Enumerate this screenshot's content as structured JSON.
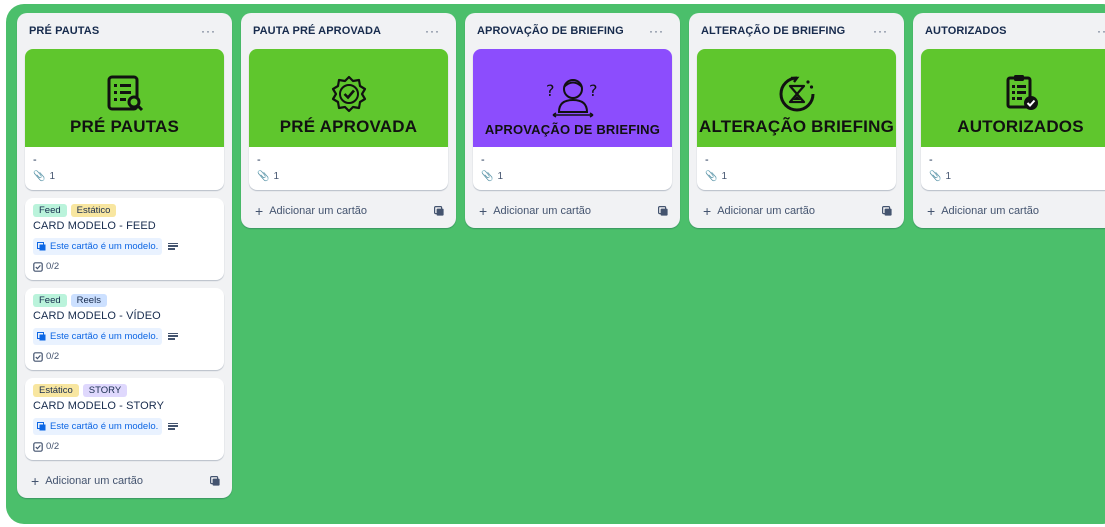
{
  "colors": {
    "board_bg": "#4bbf6b",
    "cover_green": "#5fc62d",
    "cover_purple": "#8c4dfd",
    "label_feed": "#baf3db",
    "label_estatico": "#f8e6a0",
    "label_reels": "#cce0ff",
    "label_story": "#dfd8fd"
  },
  "lists": [
    {
      "title": "PRÉ PAUTAS",
      "menu": "···",
      "cover_card": {
        "cover_title": "PRÉ PAUTAS",
        "cover_color": "#5fc62d",
        "icon": "checklist-search-icon",
        "description": "-",
        "attachments": "1"
      },
      "cards": [
        {
          "labels": [
            "Feed",
            "Estático"
          ],
          "title": "CARD MODELO - FEED",
          "template_text": "Este cartão é um modelo.",
          "checklist": "0/2"
        },
        {
          "labels": [
            "Feed",
            "Reels"
          ],
          "title": "CARD MODELO - VÍDEO",
          "template_text": "Este cartão é um modelo.",
          "checklist": "0/2"
        },
        {
          "labels": [
            "Estático",
            "STORY"
          ],
          "title": "CARD MODELO - STORY",
          "template_text": "Este cartão é um modelo.",
          "checklist": "0/2"
        }
      ],
      "add_card": "Adicionar um cartão"
    },
    {
      "title": "PAUTA PRÉ APROVADA",
      "menu": "···",
      "cover_card": {
        "cover_title": "PRÉ APROVADA",
        "cover_color": "#5fc62d",
        "icon": "approved-badge-icon",
        "description": "-",
        "attachments": "1"
      },
      "add_card": "Adicionar um cartão"
    },
    {
      "title": "APROVAÇÃO DE BRIEFING",
      "menu": "···",
      "cover_card": {
        "cover_title": "APROVAÇÃO DE BRIEFING",
        "cover_color": "#8c4dfd",
        "icon": "person-question-icon",
        "description": "-",
        "attachments": "1"
      },
      "add_card": "Adicionar um cartão"
    },
    {
      "title": "ALTERAÇÃO DE BRIEFING",
      "menu": "···",
      "cover_card": {
        "cover_title": "ALTERAÇÃO BRIEFING",
        "cover_color": "#5fc62d",
        "icon": "hourglass-cycle-icon",
        "description": "-",
        "attachments": "1"
      },
      "add_card": "Adicionar um cartão"
    },
    {
      "title": "AUTORIZADOS",
      "menu": "···",
      "cover_card": {
        "cover_title": "AUTORIZADOS",
        "cover_color": "#5fc62d",
        "icon": "clipboard-check-icon",
        "description": "-",
        "attachments": "1"
      },
      "add_card": "Adicionar um cartão"
    }
  ]
}
